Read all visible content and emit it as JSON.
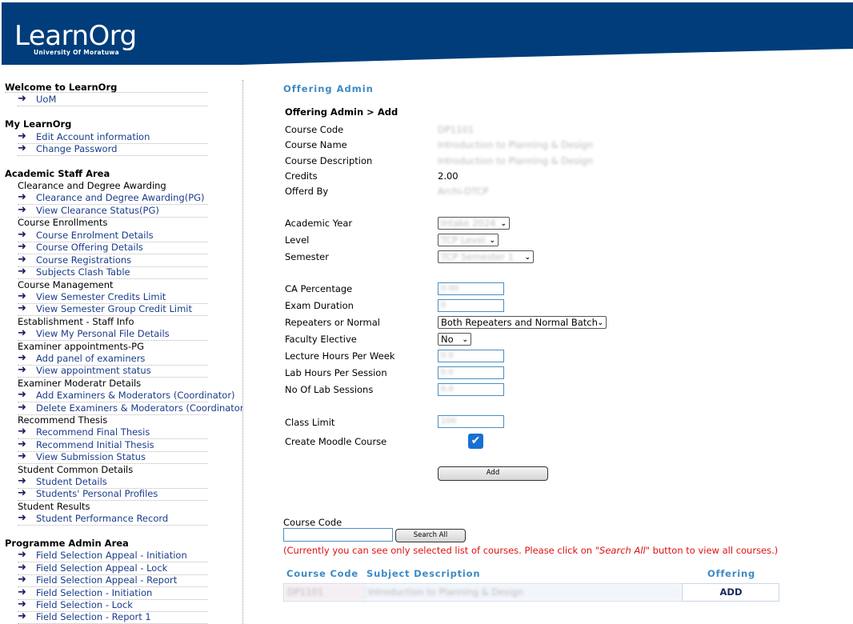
{
  "header": {
    "logo": "LearnOrg",
    "subtitle": "University Of Moratuwa"
  },
  "sidebar": {
    "welcome": {
      "title": "Welcome to LearnOrg",
      "links": [
        "UoM"
      ]
    },
    "mylearnorg": {
      "title": "My LearnOrg",
      "links": [
        "Edit Account information",
        "Change Password"
      ]
    },
    "academic": {
      "title": "Academic Staff Area",
      "groups": [
        {
          "title": "Clearance and Degree Awarding",
          "links": [
            "Clearance and Degree Awarding(PG)",
            "View Clearance Status(PG)"
          ]
        },
        {
          "title": "Course Enrollments",
          "links": [
            "Course Enrolment Details",
            "Course Offering Details",
            "Course Registrations",
            "Subjects Clash Table"
          ]
        },
        {
          "title": "Course Management",
          "links": [
            "View Semester Credits Limit",
            "View Semester Group Credit Limit"
          ]
        },
        {
          "title": "Establishment - Staff Info",
          "links": [
            "View My Personal File Details"
          ]
        },
        {
          "title": "Examiner appointments-PG",
          "links": [
            "Add panel of examiners",
            "View appointment status"
          ]
        },
        {
          "title": "Examiner Moderatr Details",
          "links": [
            "Add Examiners & Moderators (Coordinator)",
            "Delete Examiners & Moderators (Coordinator)"
          ]
        },
        {
          "title": "Recommend Thesis",
          "links": [
            "Recommend Final Thesis",
            "Recommend Initial Thesis",
            "View Submission Status"
          ]
        },
        {
          "title": "Student Common Details",
          "links": [
            "Student Details",
            "Students' Personal Profiles"
          ]
        },
        {
          "title": "Student Results",
          "links": [
            "Student Performance Record"
          ]
        }
      ]
    },
    "programme": {
      "title": "Programme Admin Area",
      "links": [
        "Field Selection Appeal - Initiation",
        "Field Selection Appeal - Lock",
        "Field Selection Appeal - Report",
        "Field Selection - Initiation",
        "Field Selection - Lock",
        "Field Selection - Report 1"
      ]
    }
  },
  "main": {
    "page_title": "Offering Admin",
    "breadcrumb": "Offering Admin > Add",
    "info": [
      {
        "label": "Course Code",
        "value": "DP1101"
      },
      {
        "label": "Course Name",
        "value": "Introduction to Planning & Design"
      },
      {
        "label": "Course Description",
        "value": "Introduction to Planning & Design"
      },
      {
        "label": "Credits",
        "value": "2.00"
      },
      {
        "label": "Offerd By",
        "value": "Archi-DTCP"
      }
    ],
    "selects": [
      {
        "label": "Academic Year",
        "value": "Intake 2024"
      },
      {
        "label": "Level",
        "value": "TCP Level"
      },
      {
        "label": "Semester",
        "value": "TCP Semester 1"
      }
    ],
    "fields": {
      "ca_percentage": {
        "label": "CA Percentage",
        "value": "0.00"
      },
      "exam_duration": {
        "label": "Exam Duration",
        "value": "0"
      },
      "repeaters": {
        "label": "Repeaters or Normal",
        "value": "Both Repeaters and Normal Batch"
      },
      "faculty_elective": {
        "label": "Faculty Elective",
        "value": "No"
      },
      "lecture_hours": {
        "label": "Lecture Hours Per Week",
        "value": "0.0"
      },
      "lab_hours": {
        "label": "Lab Hours Per Session",
        "value": "0.0"
      },
      "lab_sessions": {
        "label": "No Of Lab Sessions",
        "value": "0.0"
      },
      "class_limit": {
        "label": "Class Limit",
        "value": "100"
      },
      "moodle": {
        "label": "Create Moodle Course",
        "checked": true
      }
    },
    "add_button": "Add",
    "search": {
      "label": "Course Code",
      "value": "",
      "button": "Search All",
      "notice_pre": "(Currently you can see only selected list of courses. Please click on ",
      "notice_em": "\"Search All\"",
      "notice_post": " button to view all courses.)"
    },
    "table": {
      "headers": [
        "Course Code",
        "Subject Description",
        "Offering"
      ],
      "rows": [
        {
          "code": "DP1101",
          "description": "Introduction to Planning & Design",
          "action": "ADD"
        }
      ]
    }
  }
}
